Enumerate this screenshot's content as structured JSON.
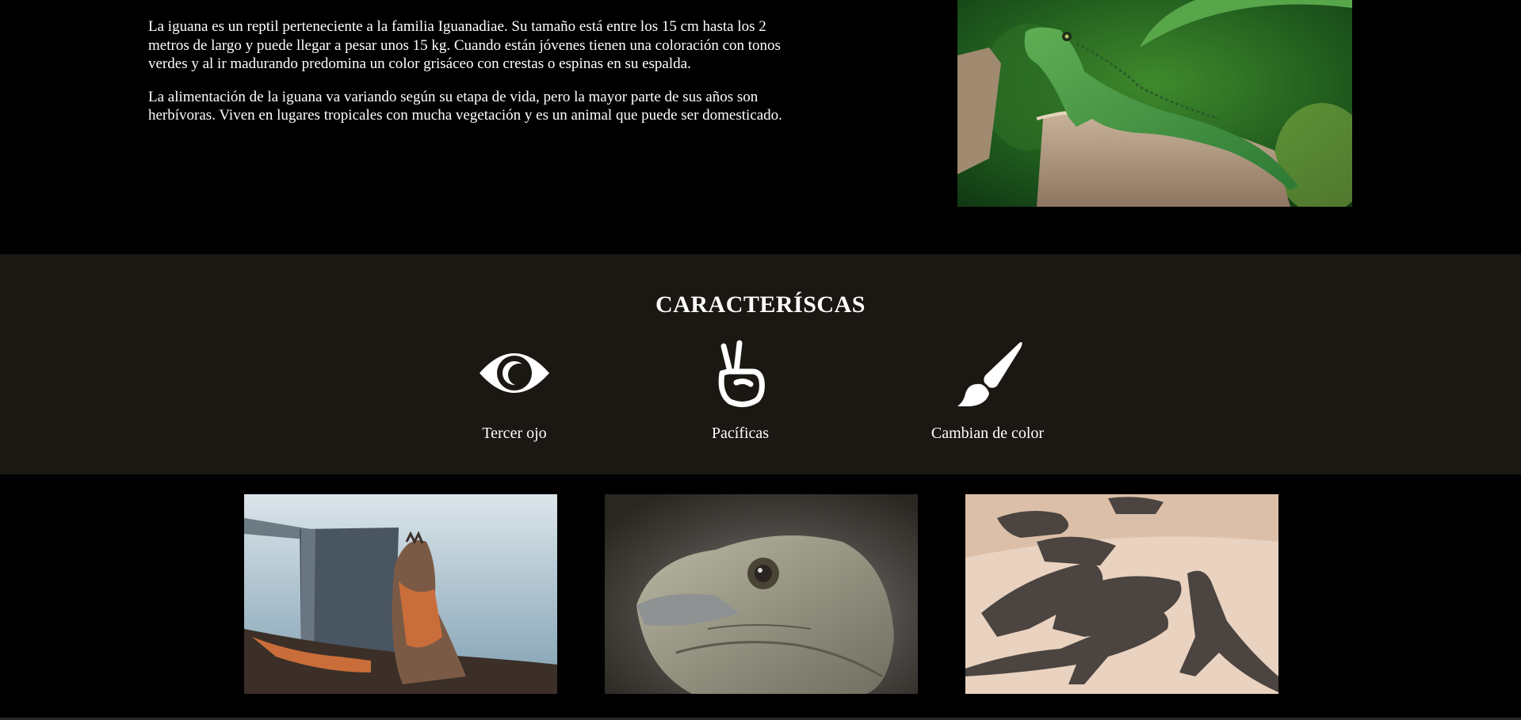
{
  "intro": {
    "paragraph_1": "La iguana es un reptil perteneciente a la familia Iguanadiae. Su tamaño está entre los 15 cm hasta los 2 metros de largo y puede llegar a pesar unos 15 kg. Cuando están jóvenes tienen una coloración con tonos verdes y al ir madurando predomina un color grisáceo con crestas o espinas en su espalda.",
    "paragraph_2": "La alimentación de la iguana va variando según su etapa de vida, pero la mayor parte de sus años son herbívoras. Viven en lugares tropicales con mucha vegetación y es un animal que puede ser domesticado."
  },
  "features": {
    "title": "CARACTERÍSCAS",
    "items": [
      {
        "icon": "eye-icon",
        "label": "Tercer ojo"
      },
      {
        "icon": "peace-hand-icon",
        "label": "Pacíficas"
      },
      {
        "icon": "paintbrush-icon",
        "label": "Cambian de color"
      }
    ]
  },
  "colors": {
    "page_background": "#000000",
    "features_background": "#1b1712",
    "text": "#ffffff"
  }
}
